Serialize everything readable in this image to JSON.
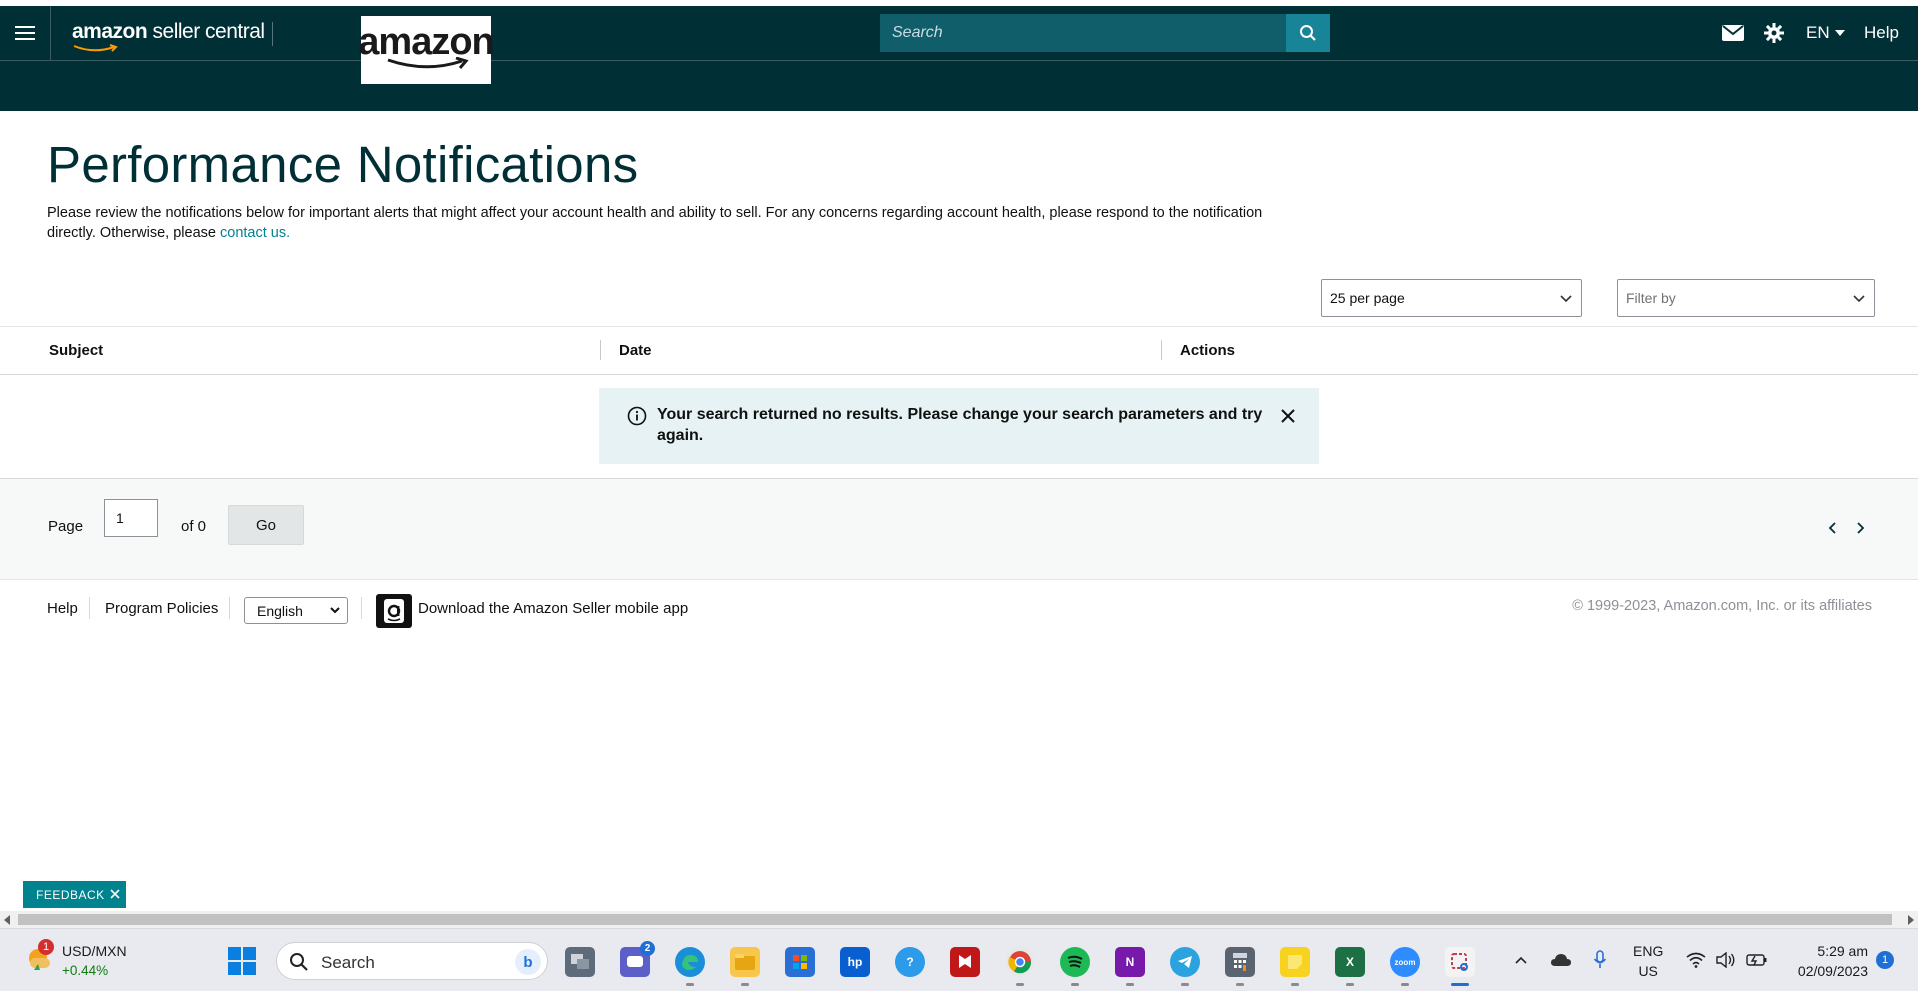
{
  "header": {
    "brand_bold": "amazon",
    "brand_light": " seller central",
    "logo_text": "amazon",
    "search_placeholder": "Search",
    "lang": "EN",
    "help": "Help"
  },
  "page": {
    "title": "Performance Notifications",
    "description": "Please review the notifications below for important alerts that might affect your account health and ability to sell. For any concerns regarding account health, please respond to the notification directly. Otherwise, please ",
    "contact_link": "contact us.",
    "per_page_selected": "25 per page",
    "filter_placeholder": "Filter by"
  },
  "table": {
    "columns": [
      "Subject",
      "Date",
      "Actions"
    ],
    "rows": []
  },
  "alert": {
    "message": "Your search returned no results. Please change your search parameters and try again."
  },
  "pagination": {
    "page_label": "Page",
    "current_page": "1",
    "of_label": "of 0",
    "go_label": "Go"
  },
  "footer": {
    "help": "Help",
    "policies": "Program Policies",
    "language_selected": "English",
    "download": "Download the Amazon Seller mobile app",
    "copyright": "© 1999-2023, Amazon.com, Inc. or its affiliates"
  },
  "feedback": {
    "label": "FEEDBACK"
  },
  "taskbar": {
    "widget_badge": "1",
    "ticker_name": "USD/MXN",
    "ticker_change": "+0.44%",
    "search_label": "Search",
    "teams_badge": "2",
    "lang_line1": "ENG",
    "lang_line2": "US",
    "time": "5:29 am",
    "date": "02/09/2023",
    "notifications_count": "1"
  },
  "colors": {
    "header_bg": "#002f36",
    "search_bg": "#0f5e6a",
    "search_button": "#178597",
    "link": "#008296",
    "alert_bg": "#e6f2f3",
    "feedback_bg": "#00838f"
  }
}
